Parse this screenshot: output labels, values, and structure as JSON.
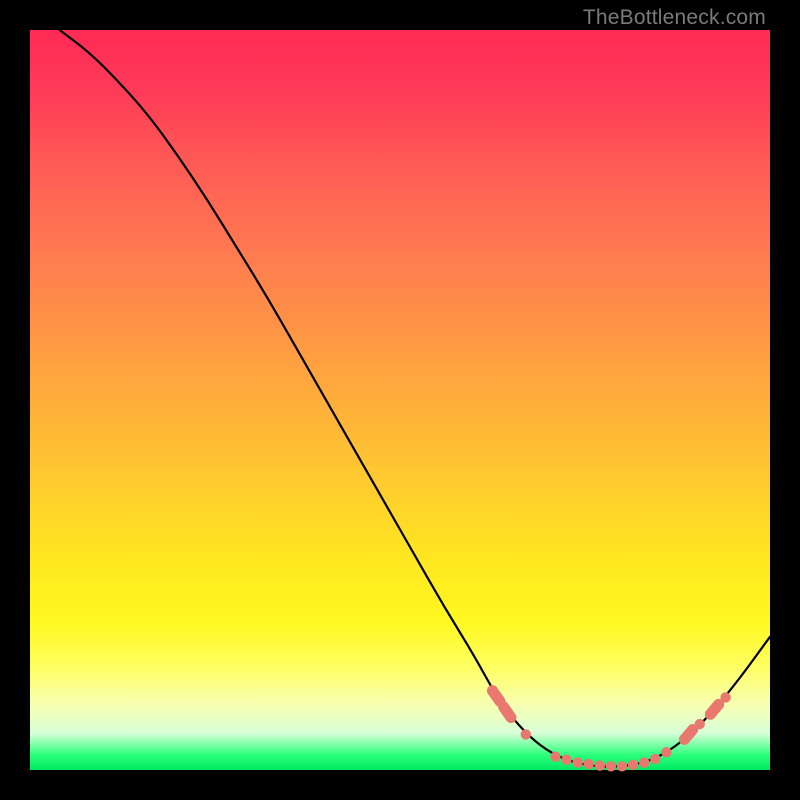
{
  "watermark": "TheBottleneck.com",
  "colors": {
    "marker": "#e9786e",
    "line": "#000000",
    "gradient_top": "#ff2a55",
    "gradient_bottom": "#00e860"
  },
  "chart_data": {
    "type": "line",
    "title": "",
    "xlabel": "",
    "ylabel": "",
    "xlim": [
      0,
      100
    ],
    "ylim": [
      0,
      100
    ],
    "grid": false,
    "legend": false,
    "series": [
      {
        "name": "bottleneck-curve",
        "x": [
          4,
          8,
          12,
          16,
          20,
          24,
          28,
          32,
          36,
          40,
          44,
          48,
          52,
          56,
          60,
          63,
          66,
          69,
          72,
          75,
          78,
          81,
          84,
          87,
          90,
          93,
          96,
          100
        ],
        "y": [
          100,
          97,
          93,
          88.5,
          83,
          77,
          70.5,
          64,
          57,
          50,
          43,
          36,
          29,
          22,
          15.5,
          10,
          6,
          3.2,
          1.5,
          0.7,
          0.4,
          0.6,
          1.3,
          3,
          5.5,
          8.8,
          12.5,
          18
        ]
      }
    ],
    "markers": {
      "name": "highlighted-points",
      "points": [
        {
          "x": 63.0,
          "y": 10.0,
          "size": "large"
        },
        {
          "x": 64.5,
          "y": 7.8,
          "size": "large"
        },
        {
          "x": 67.0,
          "y": 4.8,
          "size": "small"
        },
        {
          "x": 71.0,
          "y": 1.8,
          "size": "small"
        },
        {
          "x": 72.5,
          "y": 1.4,
          "size": "small"
        },
        {
          "x": 74.0,
          "y": 1.0,
          "size": "small"
        },
        {
          "x": 75.5,
          "y": 0.8,
          "size": "small"
        },
        {
          "x": 77.0,
          "y": 0.6,
          "size": "small"
        },
        {
          "x": 78.5,
          "y": 0.5,
          "size": "small"
        },
        {
          "x": 80.0,
          "y": 0.5,
          "size": "small"
        },
        {
          "x": 81.5,
          "y": 0.7,
          "size": "small"
        },
        {
          "x": 83.0,
          "y": 1.0,
          "size": "small"
        },
        {
          "x": 84.5,
          "y": 1.5,
          "size": "small"
        },
        {
          "x": 86.0,
          "y": 2.4,
          "size": "small"
        },
        {
          "x": 89.0,
          "y": 4.8,
          "size": "large"
        },
        {
          "x": 90.5,
          "y": 6.2,
          "size": "small"
        },
        {
          "x": 92.5,
          "y": 8.2,
          "size": "large"
        },
        {
          "x": 94.0,
          "y": 9.8,
          "size": "small"
        }
      ]
    }
  }
}
